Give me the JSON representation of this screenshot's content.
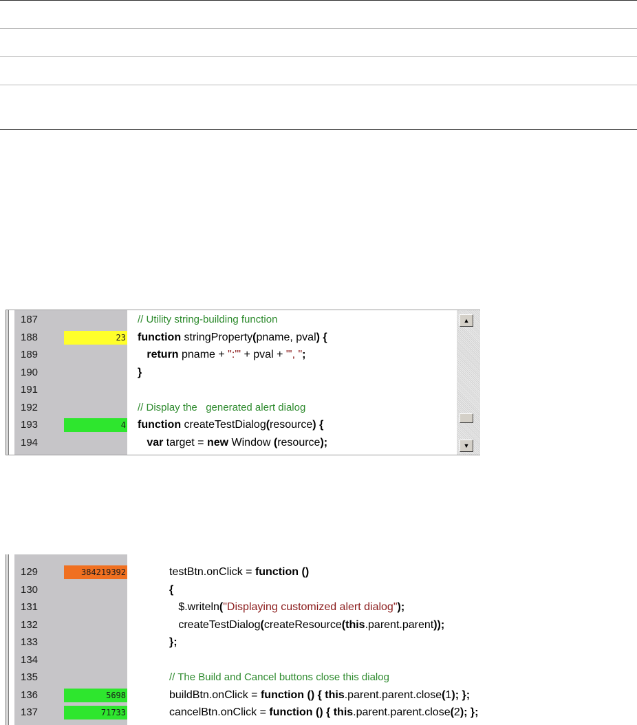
{
  "panel1": {
    "rows": [
      {
        "line": "187",
        "count": "",
        "code_parts": [
          {
            "t": "// Utility string-building function",
            "k": "cm"
          }
        ]
      },
      {
        "line": "188",
        "count": "23",
        "count_color": "#ffff2a",
        "code_parts": [
          {
            "t": "function",
            "k": "kw"
          },
          {
            "t": " stringProperty",
            "k": ""
          },
          {
            "t": "(",
            "k": "kw"
          },
          {
            "t": "pname, pval",
            "k": ""
          },
          {
            "t": ") {",
            "k": "kw"
          }
        ]
      },
      {
        "line": "189",
        "count": "",
        "code_parts": [
          {
            "t": "   return",
            "k": "kw"
          },
          {
            "t": " pname + ",
            "k": ""
          },
          {
            "t": "\":'\"",
            "k": "st"
          },
          {
            "t": " + pval + ",
            "k": ""
          },
          {
            "t": "\"', \"",
            "k": "st"
          },
          {
            "t": ";",
            "k": "kw"
          }
        ]
      },
      {
        "line": "190",
        "count": "",
        "code_parts": [
          {
            "t": "}",
            "k": "kw"
          }
        ]
      },
      {
        "line": "191",
        "count": "",
        "code_parts": []
      },
      {
        "line": "192",
        "count": "",
        "code_parts": [
          {
            "t": "// Display the   generated alert dialog",
            "k": "cm"
          }
        ]
      },
      {
        "line": "193",
        "count": "4",
        "count_color": "#2ee62e",
        "code_parts": [
          {
            "t": "function",
            "k": "kw"
          },
          {
            "t": " createTestDialog",
            "k": ""
          },
          {
            "t": "(",
            "k": "kw"
          },
          {
            "t": "resource",
            "k": ""
          },
          {
            "t": ") {",
            "k": "kw"
          }
        ]
      },
      {
        "line": "194",
        "count": "",
        "code_parts": [
          {
            "t": "   var",
            "k": "kw"
          },
          {
            "t": " target = ",
            "k": ""
          },
          {
            "t": "new",
            "k": "kw"
          },
          {
            "t": " Window ",
            "k": ""
          },
          {
            "t": "(",
            "k": "kw"
          },
          {
            "t": "resource",
            "k": ""
          },
          {
            "t": ");",
            "k": "kw"
          }
        ]
      }
    ],
    "scroll_up_icon": "arrow-up-icon",
    "scroll_down_icon": "arrow-down-icon"
  },
  "panel2": {
    "rows": [
      {
        "line": "129",
        "count": "384219392",
        "count_color": "#f07020",
        "code_parts": [
          {
            "t": "testBtn.onClick = ",
            "k": ""
          },
          {
            "t": "function ()",
            "k": "kw"
          }
        ]
      },
      {
        "line": "130",
        "count": "",
        "code_parts": [
          {
            "t": "{",
            "k": "kw"
          }
        ]
      },
      {
        "line": "131",
        "count": "",
        "code_parts": [
          {
            "t": "   $.writeln",
            "k": ""
          },
          {
            "t": "(",
            "k": "kw"
          },
          {
            "t": "\"Displaying customized alert dialog\"",
            "k": "st"
          },
          {
            "t": ");",
            "k": "kw"
          }
        ]
      },
      {
        "line": "132",
        "count": "",
        "code_parts": [
          {
            "t": "   createTestDialog",
            "k": ""
          },
          {
            "t": "(",
            "k": "kw"
          },
          {
            "t": "createResource",
            "k": ""
          },
          {
            "t": "(",
            "k": "kw"
          },
          {
            "t": "this",
            "k": "kw"
          },
          {
            "t": ".parent.parent",
            "k": ""
          },
          {
            "t": "));",
            "k": "kw"
          }
        ]
      },
      {
        "line": "133",
        "count": "",
        "code_parts": [
          {
            "t": "};",
            "k": "kw"
          }
        ]
      },
      {
        "line": "134",
        "count": "",
        "code_parts": []
      },
      {
        "line": "135",
        "count": "",
        "code_parts": [
          {
            "t": "// The Build and Cancel buttons close this dialog",
            "k": "cm"
          }
        ]
      },
      {
        "line": "136",
        "count": "5698",
        "count_color": "#2ee62e",
        "code_parts": [
          {
            "t": "buildBtn.onClick = ",
            "k": ""
          },
          {
            "t": "function () { this",
            "k": "kw"
          },
          {
            "t": ".parent.parent.close",
            "k": ""
          },
          {
            "t": "(",
            "k": "kw"
          },
          {
            "t": "1",
            "k": ""
          },
          {
            "t": "); };",
            "k": "kw"
          }
        ]
      },
      {
        "line": "137",
        "count": "71733",
        "count_color": "#2ee62e",
        "code_parts": [
          {
            "t": "cancelBtn.onClick = ",
            "k": ""
          },
          {
            "t": "function () { this",
            "k": "kw"
          },
          {
            "t": ".parent.parent.close",
            "k": ""
          },
          {
            "t": "(",
            "k": "kw"
          },
          {
            "t": "2",
            "k": ""
          },
          {
            "t": "); };",
            "k": "kw"
          }
        ]
      }
    ]
  }
}
